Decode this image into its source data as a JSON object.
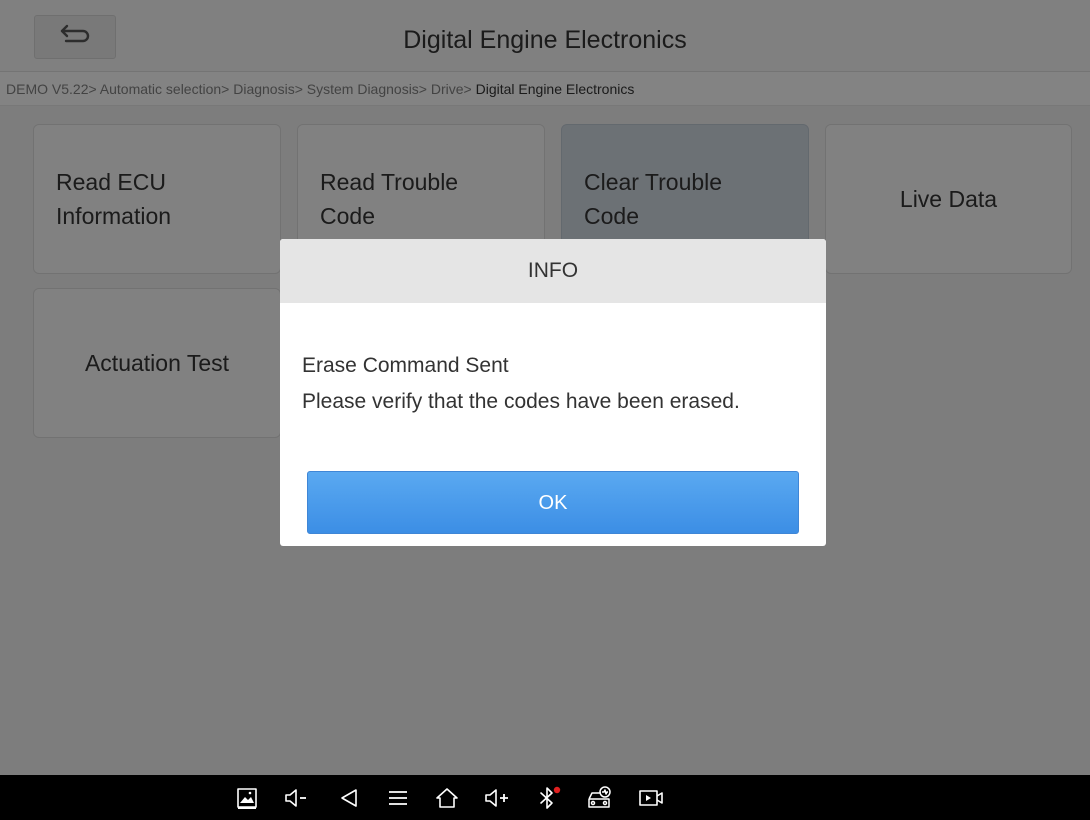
{
  "header": {
    "title": "Digital Engine Electronics"
  },
  "breadcrumb": {
    "path": "DEMO V5.22> Automatic selection> Diagnosis> System Diagnosis> Drive> ",
    "current": "Digital Engine Electronics"
  },
  "menu": {
    "read_ecu_line1": "Read ECU",
    "read_ecu_line2": "Information",
    "read_codes_line1": "Read Trouble",
    "read_codes_line2": "Code",
    "clear_codes_line1": "Clear Trouble",
    "clear_codes_line2": "Code",
    "live_data": "Live Data",
    "actuation_test": "Actuation Test"
  },
  "dialog": {
    "title": "INFO",
    "line1": "Erase Command Sent",
    "line2": "Please verify that the codes have been erased.",
    "ok_label": "OK"
  },
  "navbar": {
    "icons": [
      "screenshot-icon",
      "volume-down-icon",
      "back-icon",
      "menu-icon",
      "home-icon",
      "volume-up-icon",
      "bluetooth-icon",
      "vehicle-diagnostic-icon",
      "screen-record-icon"
    ]
  },
  "colors": {
    "ok_button": "#3c8ee5",
    "bluetooth_alert": "#e02020",
    "navbar": "#000000"
  }
}
